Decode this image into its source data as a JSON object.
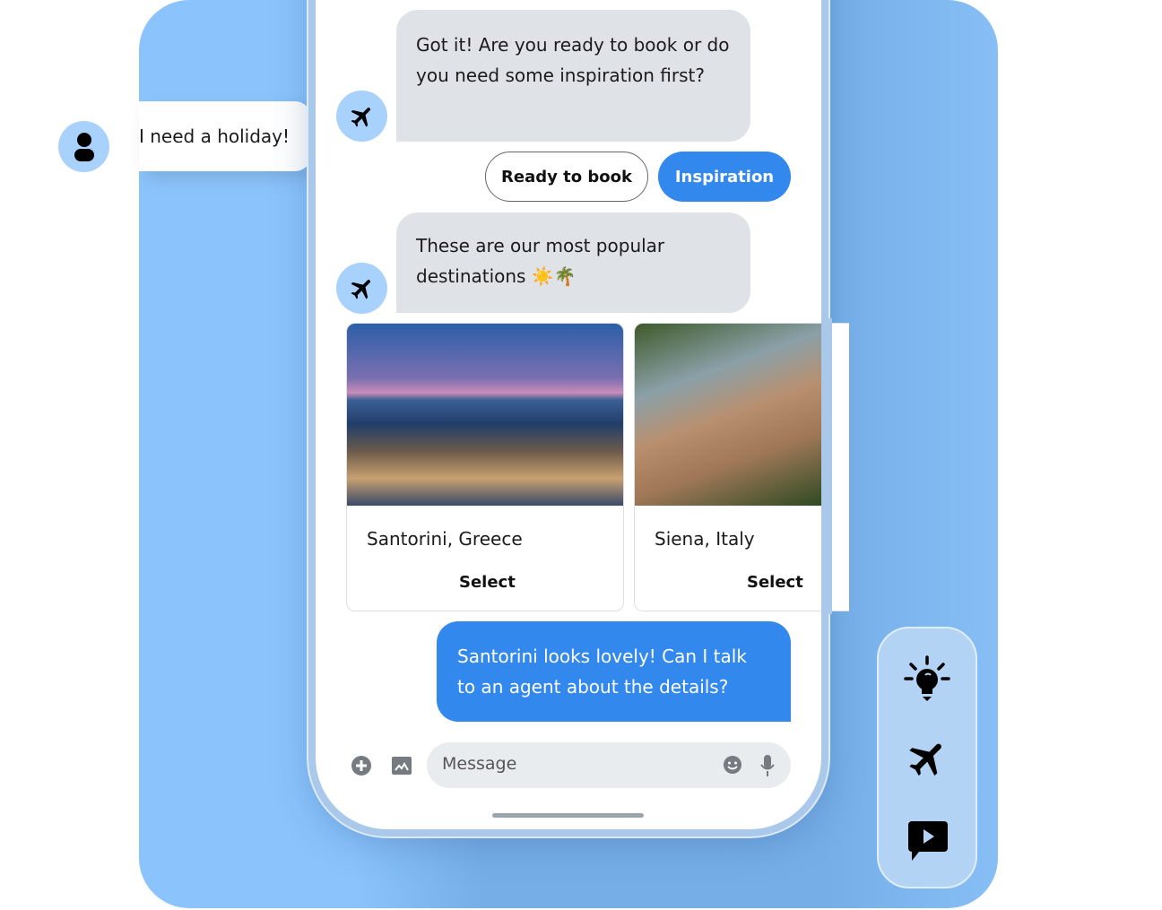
{
  "user_message": "I need a holiday!",
  "bot_messages": [
    "Got it! Are you ready to book or do you need some inspiration first?",
    "These are our most popular destinations ☀️🌴"
  ],
  "chips": {
    "ready": "Ready to book",
    "inspiration": "Inspiration"
  },
  "cards": [
    {
      "title": "Santorini, Greece",
      "action": "Select"
    },
    {
      "title": "Siena, Italy",
      "action": "Select"
    }
  ],
  "outgoing_message": "Santorini looks lovely! Can I talk to an agent about the details?",
  "composer": {
    "placeholder": "Message"
  },
  "side_icons": [
    "lightbulb-icon",
    "airplane-icon",
    "video-chat-icon"
  ],
  "colors": {
    "accent": "#3388ee",
    "avatar": "#a8d1fb",
    "bubble": "#dfe3e8",
    "background": "#8bc4fc"
  }
}
